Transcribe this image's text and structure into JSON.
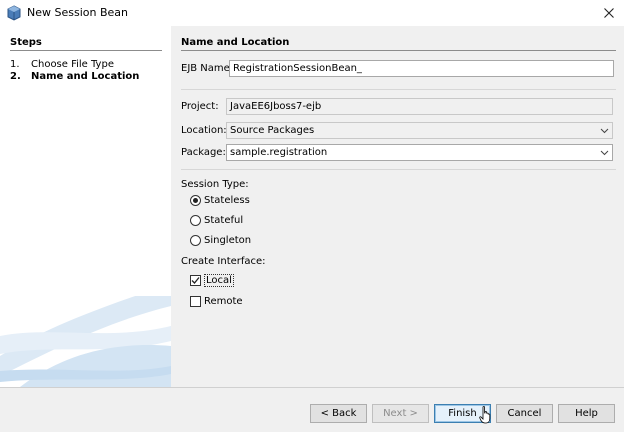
{
  "window": {
    "title": "New Session Bean",
    "icon": "session-bean-icon",
    "close_icon": "close-icon"
  },
  "steps": {
    "title": "Steps",
    "items": [
      {
        "num": "1.",
        "label": "Choose File Type"
      },
      {
        "num": "2.",
        "label": "Name and Location"
      }
    ]
  },
  "form": {
    "section_title": "Name and Location",
    "ejb_name_label": "EJB Name:",
    "ejb_name_value": "RegistrationSessionBean_",
    "project_label": "Project:",
    "project_value": "JavaEE6Jboss7-ejb",
    "location_label": "Location:",
    "location_value": "Source Packages",
    "package_label": "Package:",
    "package_value": "sample.registration",
    "session_type_label": "Session Type:",
    "session_types": [
      {
        "label": "Stateless",
        "selected": true
      },
      {
        "label": "Stateful",
        "selected": false
      },
      {
        "label": "Singleton",
        "selected": false
      }
    ],
    "create_interface_label": "Create Interface:",
    "interfaces": [
      {
        "label": "Local",
        "checked": true
      },
      {
        "label": "Remote",
        "checked": false
      }
    ]
  },
  "buttons": {
    "back": "< Back",
    "next": "Next >",
    "finish": "Finish",
    "cancel": "Cancel",
    "help": "Help"
  },
  "colors": {
    "dialog_bg": "#f0f0f0",
    "panel_bg": "#ffffff",
    "focus_border": "#3c7fb1",
    "swoosh": "#cfe2f2"
  }
}
